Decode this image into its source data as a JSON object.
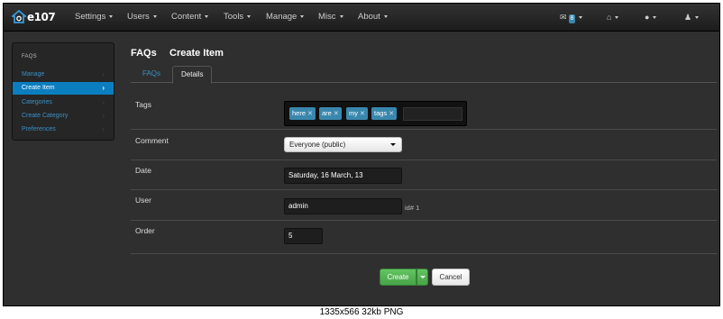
{
  "app": {
    "logo_text": "e107"
  },
  "navbar": {
    "items": [
      {
        "label": "Settings"
      },
      {
        "label": "Users"
      },
      {
        "label": "Content"
      },
      {
        "label": "Tools"
      },
      {
        "label": "Manage"
      },
      {
        "label": "Misc"
      },
      {
        "label": "About"
      }
    ],
    "messages_badge": "8",
    "icons": [
      "mail-icon",
      "home-icon",
      "globe-icon",
      "user-icon"
    ]
  },
  "sidebar": {
    "title": "FAQS",
    "items": [
      {
        "label": "Manage",
        "active": false
      },
      {
        "label": "Create Item",
        "active": true
      },
      {
        "label": "Categories",
        "active": false
      },
      {
        "label": "Create Category",
        "active": false
      },
      {
        "label": "Preferences",
        "active": false
      }
    ]
  },
  "header": {
    "section": "FAQs",
    "page": "Create Item"
  },
  "tabs": [
    {
      "label": "FAQs",
      "active": false
    },
    {
      "label": "Details",
      "active": true
    }
  ],
  "form": {
    "tags_label": "Tags",
    "tags": [
      "here",
      "are",
      "my",
      "tags"
    ],
    "comment_label": "Comment",
    "comment_value": "Everyone (public)",
    "date_label": "Date",
    "date_value": "Saturday, 16 March, 13",
    "user_label": "User",
    "user_value": "admin",
    "user_id_text": "id# 1",
    "order_label": "Order",
    "order_value": "5"
  },
  "buttons": {
    "create": "Create",
    "cancel": "Cancel"
  },
  "footer": {
    "caption": "1335x566 32kb PNG"
  }
}
